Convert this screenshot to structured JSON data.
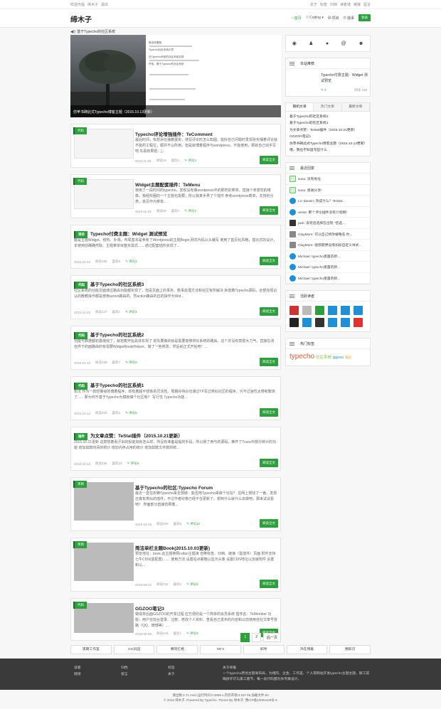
{
  "topbar": {
    "left": [
      "欢迎光临",
      "缔木子",
      "退出"
    ],
    "right": [
      "关于",
      "标签",
      "归档",
      "读者墙",
      "链接",
      "留言"
    ]
  },
  "header": {
    "logo": "缔木子",
    "nav": [
      {
        "label": "首页",
        "icon": "⌂",
        "active": true
      },
      {
        "label": "Coding ▾",
        "icon": "☉"
      },
      {
        "label": "项目",
        "icon": "▤"
      },
      {
        "label": "独事",
        "icon": "◷"
      }
    ],
    "register": "登录"
  },
  "announcement": "基于Typecho的社区系统",
  "slider": {
    "caption": "仿苹书碑此式Typecho博客主题（2015.10.13更新）",
    "shot_lines": [
      "首页效果图",
      "Typecho社区系统示意",
      "社Typecho系统的社区系统实现",
      "开放，基于Typecho的社区系统"
    ]
  },
  "posts": [
    {
      "title": "Typecho评论增强插件：TeComment",
      "excerpt": "最后时间，有想添在播着展资，搜及评论时怎么知圆。能好自己问题时发现张实播着评论就不能的工程位，顺并不以所用。但是就博着程序与wordpress，不能使用，那就自己动手写吧 先看效果把：[...",
      "date": "2015-11-04",
      "views": "阅读19",
      "likes": "喜欢1",
      "comments": "评论3",
      "more": "阅读全文",
      "badge": "代码"
    },
    {
      "title": "Widget主题配套插件：TeMenu",
      "excerpt": "使用了一段时间的typecho，发现没有像wordpress中的那样的菜单，直接个单感觉的博像，我经所圈的一个主题也需要，所以我真手弄了个插件 参考wordpress菜单，支持的分类，单页作为菜单...",
      "date": "2015-11-03",
      "views": "阅读38",
      "likes": "喜欢1",
      "comments": "评论3",
      "more": "阅读全文",
      "badge": "代码"
    },
    {
      "title": "Typecho付费主题：Widget 测试预览",
      "excerpt": "都是主题Widget，结构、外观。布局基本是参考了Wordpress的主题Begin,网式代码从头编写 使用了首页化风格，插比式的设计，本使用前确确然取。主题菜单目整本需式...... 通过配套插件实现了...",
      "date": "2015-10-23",
      "views": "阅读185",
      "likes": "喜欢9",
      "comments": "评论3",
      "more": "阅读全文",
      "badge": "项目"
    },
    {
      "title": "基于Typecho的社区系统3",
      "excerpt": "社区系统的功能页面通过路由功能都实现了，但是页面上的事务、数事处理方法和社区有所解决 就借着Typecho源码，全部完观识认的教教操作都是使用action路由的，然action路由的应的操作为Wid...",
      "date": "2015-10-23",
      "views": "阅读137",
      "likes": "喜欢1",
      "comments": "评论4",
      "more": "阅读全文",
      "badge": "代码"
    },
    {
      "title": "基于Typecho的社区系统2",
      "excerpt": "功能与数据都初露端倪了，就想着开始具体实现了 前先要做的就是需要能够将化系统的路由。这个并没有意很大力气，直接在改自界下的面路由的有需要WidgetRouteHelper，做了一些修改，然后就正式开始吧！...",
      "date": "2015-10-15",
      "views": "阅读139",
      "likes": "喜欢7",
      "comments": "评论0",
      "more": "阅读全文",
      "badge": "代码"
    },
    {
      "title": "基于Typecho的社区系统1",
      "excerpt": "想法 作为一款轻量级的博着程序，却有着超平想象的灵活性。周期好待白也通过TP写过类似社区的程序，只不过速性太慢和繁琐了...... 那为何不基于Typecho为模板做个社区呢？ 写行性 Typecho功能...",
      "date": "2015-10-14",
      "views": "阅读202",
      "likes": "喜欢5",
      "comments": "评论8",
      "more": "阅读全文",
      "badge": "代码"
    },
    {
      "title": "为文章点赞：TeStat插件（2015.10.21更新）",
      "excerpt": "2015.10.21更新 这弊想着看汗出的投能如就怎么样，所没有准备是提的手段，所以我了用与的源码，推开了Trace中部分统计的功能 增加如数时间的统计 增加内存占用的统计 增加如数文件数的统...",
      "date": "2015-10-13",
      "views": "阅读236",
      "likes": "喜欢23",
      "comments": "评论6",
      "more": "阅读全文",
      "badge": "插件"
    },
    {
      "title": "基于Typecho的社区:Typecho Forum",
      "excerpt": "最近一直在折腾Typecho来支部做：能否用Typecho来做个论坛？ 在网上搜找了一番，发现还真有类似的插件，不过作者好像已经不在更新了。想到什么就什么去做吧，那来试试看吧！ 界面部分直接仿照着...",
      "date": "2015-10-03",
      "views": "阅读460",
      "likes": "喜欢5",
      "comments": "评论12",
      "more": "阅读全文",
      "badge": "项目"
    },
    {
      "title": "简洁单栏主题Book(2015.10.03更新)",
      "excerpt": "预览地址：book 此主题参照ruifan主题演 自带标签、归档、链接（需插件）页面 附件支持七牛CDN(需配置) ...... 使用方法 设置站点邮箱以显示头像 设置CDN地址以加速附件 设置和以...",
      "date": "2015-08-22",
      "views": "阅读722",
      "likes": "喜欢5",
      "comments": "评论6",
      "more": "阅读全文",
      "badge": "项目"
    },
    {
      "title": "GGZOO笔记3",
      "excerpt": "做成单后面GGZOO的开发过程 应方便的是一个简单的会员系统 插件名：TeMember 功能：用户在前台登录、注册、修改个人资料、查看自己发布的内容和以前使用自社文章号管路（QQ、微博等）...",
      "date": "2015-08-09",
      "views": "阅读444",
      "likes": "喜欢1",
      "comments": "评论0",
      "more": "阅读全文",
      "badge": "代码"
    }
  ],
  "pager": {
    "pages": [
      "1",
      "2"
    ],
    "next": "后一页"
  },
  "side": {
    "recommend": {
      "title": "本站推荐",
      "item": "Typecho付费主题：Widget 测试预览",
      "comments": "3",
      "views": "阅读 185"
    },
    "tabs": [
      "随机文章",
      "热门文章",
      "最新文章"
    ],
    "random": [
      "基于Typecho的社区系统2",
      "基于Typecho的社区系统1",
      "为文章点赞：TeStat插件（2015.10.21更新）",
      "GGZOO笔记1",
      "仿苹书碑此式Typecho博客主题（2015.10.13更新）",
      "喂，我也不知道写些什么"
    ],
    "recent_title": "最近回复",
    "recent": [
      {
        "text": "susu: 没有地址",
        "av": "green"
      },
      {
        "text": "susu: 感谢分享!",
        "av": "green"
      },
      {
        "text": "LC-daoxin: 改成什么？TeStat...",
        "av": "blue"
      },
      {
        "text": "antior: 那个评论插件没有介绍啊！",
        "av": "blue"
      },
      {
        "text": "jack: 安装后选择在出现 \"您选...",
        "av": "dark"
      },
      {
        "text": "ClayMore: 可以自己修改缓略名 你...",
        "av": "gray"
      },
      {
        "text": "ClayMore: 能够随便设增加加自定义样式...",
        "av": "gray"
      },
      {
        "text": "Michael: typecho墨菌的新...",
        "av": "blue"
      },
      {
        "text": "Michael: typecho墨菌的新...",
        "av": "blue"
      },
      {
        "text": "Michael: typecho墨菌的新...",
        "av": "blue"
      }
    ],
    "guests_title": "活跃读者",
    "tags_title": "热门标签",
    "tags": [
      {
        "t": "typecho",
        "c": "#e05a2b",
        "s": "10px"
      },
      {
        "t": "社区系统",
        "c": "#8bc34a",
        "s": "5.5px"
      },
      {
        "t": "ggzoo",
        "c": "#1f8fd8",
        "s": "5.5px"
      },
      {
        "t": "笔记",
        "c": "#e89b00",
        "s": "4.5px"
      }
    ]
  },
  "footer_links": [
    "思期工作室",
    "GG乐园",
    "赛同忆格",
    "Mir's",
    "如呼",
    "浜在博着",
    "圃知识"
  ],
  "footer": {
    "cols": [
      [
        "读者",
        "链接"
      ],
      [
        "归档",
        "留言"
      ],
      [
        "标签",
        "关于"
      ]
    ],
    "about_title": "关于缔着",
    "about": "一个typecho原创主题发布局，为相的、企金、工作室、个人等网站开发typecho主题主题。赋工前确接吁可与美工路节，每一段代码都为你专属设计。"
  },
  "copy": [
    "请出数:2.71 ms/s,运行时间:0.3685 s,内存开销:4.537 kb,加载文件:60",
    "© 2015 缔木子. Powered By Typecho. Theme By 缔木子. 豫ICP备10004449号-5"
  ]
}
